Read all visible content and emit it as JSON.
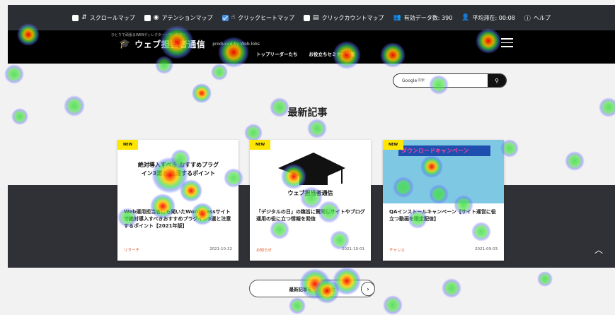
{
  "toolbar": {
    "items": [
      {
        "label": "スクロールマップ",
        "icon": "scroll-map-icon",
        "checked": false
      },
      {
        "label": "アテンションマップ",
        "icon": "eye-icon",
        "checked": false
      },
      {
        "label": "クリックヒートマップ",
        "icon": "click-icon",
        "checked": true
      },
      {
        "label": "クリックカウントマップ",
        "icon": "count-icon",
        "checked": false
      }
    ],
    "data_count": "有効データ数: 390",
    "avg_stay": "平均滞在: 00:08",
    "help": "ヘルプ"
  },
  "site": {
    "tagline": "ひとりで頑張るWEBディレクター・マーケター",
    "logo_text": "ウェブ担当者通信",
    "produced_by": "produced by Web.lobs",
    "nav": [
      "トップリーダーたち",
      "お役立ちセミナー情報"
    ]
  },
  "search": {
    "brand": "Google",
    "placeholder": "検索"
  },
  "section_title": "最新記事",
  "cards": [
    {
      "badge": "NEW",
      "thumb_text": "絶対導入すべき おすすめプラグイン3選と 注意するポイント",
      "title": "Web運用担当者にも聞いたWordPressサイトで絶対導入すべきおすすめプラグイン3選と注意するポイント【2021年版】",
      "category": "リサーチ",
      "date": "2021-10-22"
    },
    {
      "badge": "NEW",
      "thumb_text": "ウェブ担当者通信",
      "title": "「デジタルの日」の趣旨に賛同しサイトやブログ運用の役に立つ情報を発信",
      "category": "お知らせ",
      "date": "2021-10-01"
    },
    {
      "badge": "NEW",
      "thumb_text": "ダウンロードキャンペーン",
      "title": "QAインストールキャンペーン【サイト運営に役立つ動画を限定配信】",
      "category": "チャンス",
      "date": "2021-09-03"
    }
  ],
  "more_button": "最新記事をもっと読む",
  "colors": {
    "accent": "#e44c1b",
    "badge": "#ffe600",
    "dark": "#2f3136"
  }
}
